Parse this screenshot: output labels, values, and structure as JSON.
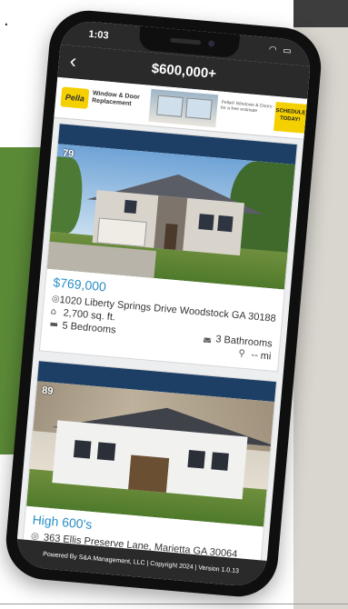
{
  "background": {
    "dot": "."
  },
  "status": {
    "time": "1:03",
    "icons": "wifi-icon battery-icon"
  },
  "nav": {
    "back_label": "‹",
    "title": "$600,000+"
  },
  "ad": {
    "logo_text": "Pella",
    "brand": "Window & Door Replacement",
    "details": "Pella® Windows & Doors · Contact for a free estimate",
    "cta": "SCHEDULE TODAY!"
  },
  "listings": [
    {
      "photo_count": "79",
      "price": "$769,000",
      "address": "1020 Liberty Springs Drive Woodstock GA 30188",
      "sqft": "2,700 sq. ft.",
      "bedrooms": "5 Bedrooms",
      "bathrooms": "3 Bathrooms",
      "distance": "-- mi"
    },
    {
      "photo_count": "89",
      "price": "High 600's",
      "address": "363 Ellis Preserve Lane, Marietta GA 30064"
    }
  ],
  "footer": {
    "text": "Powered By S&A Management, LLC | Copyright 2024 | Version 1.0.13"
  },
  "icons": {
    "pin": "location-pin-icon",
    "sqft": "area-icon",
    "bed": "bed-icon",
    "bath": "bath-icon",
    "distance": "distance-icon"
  },
  "colors": {
    "header_bar": "#1d3f66",
    "price": "#2a8fc6",
    "app_bar": "#2a2a2a"
  }
}
